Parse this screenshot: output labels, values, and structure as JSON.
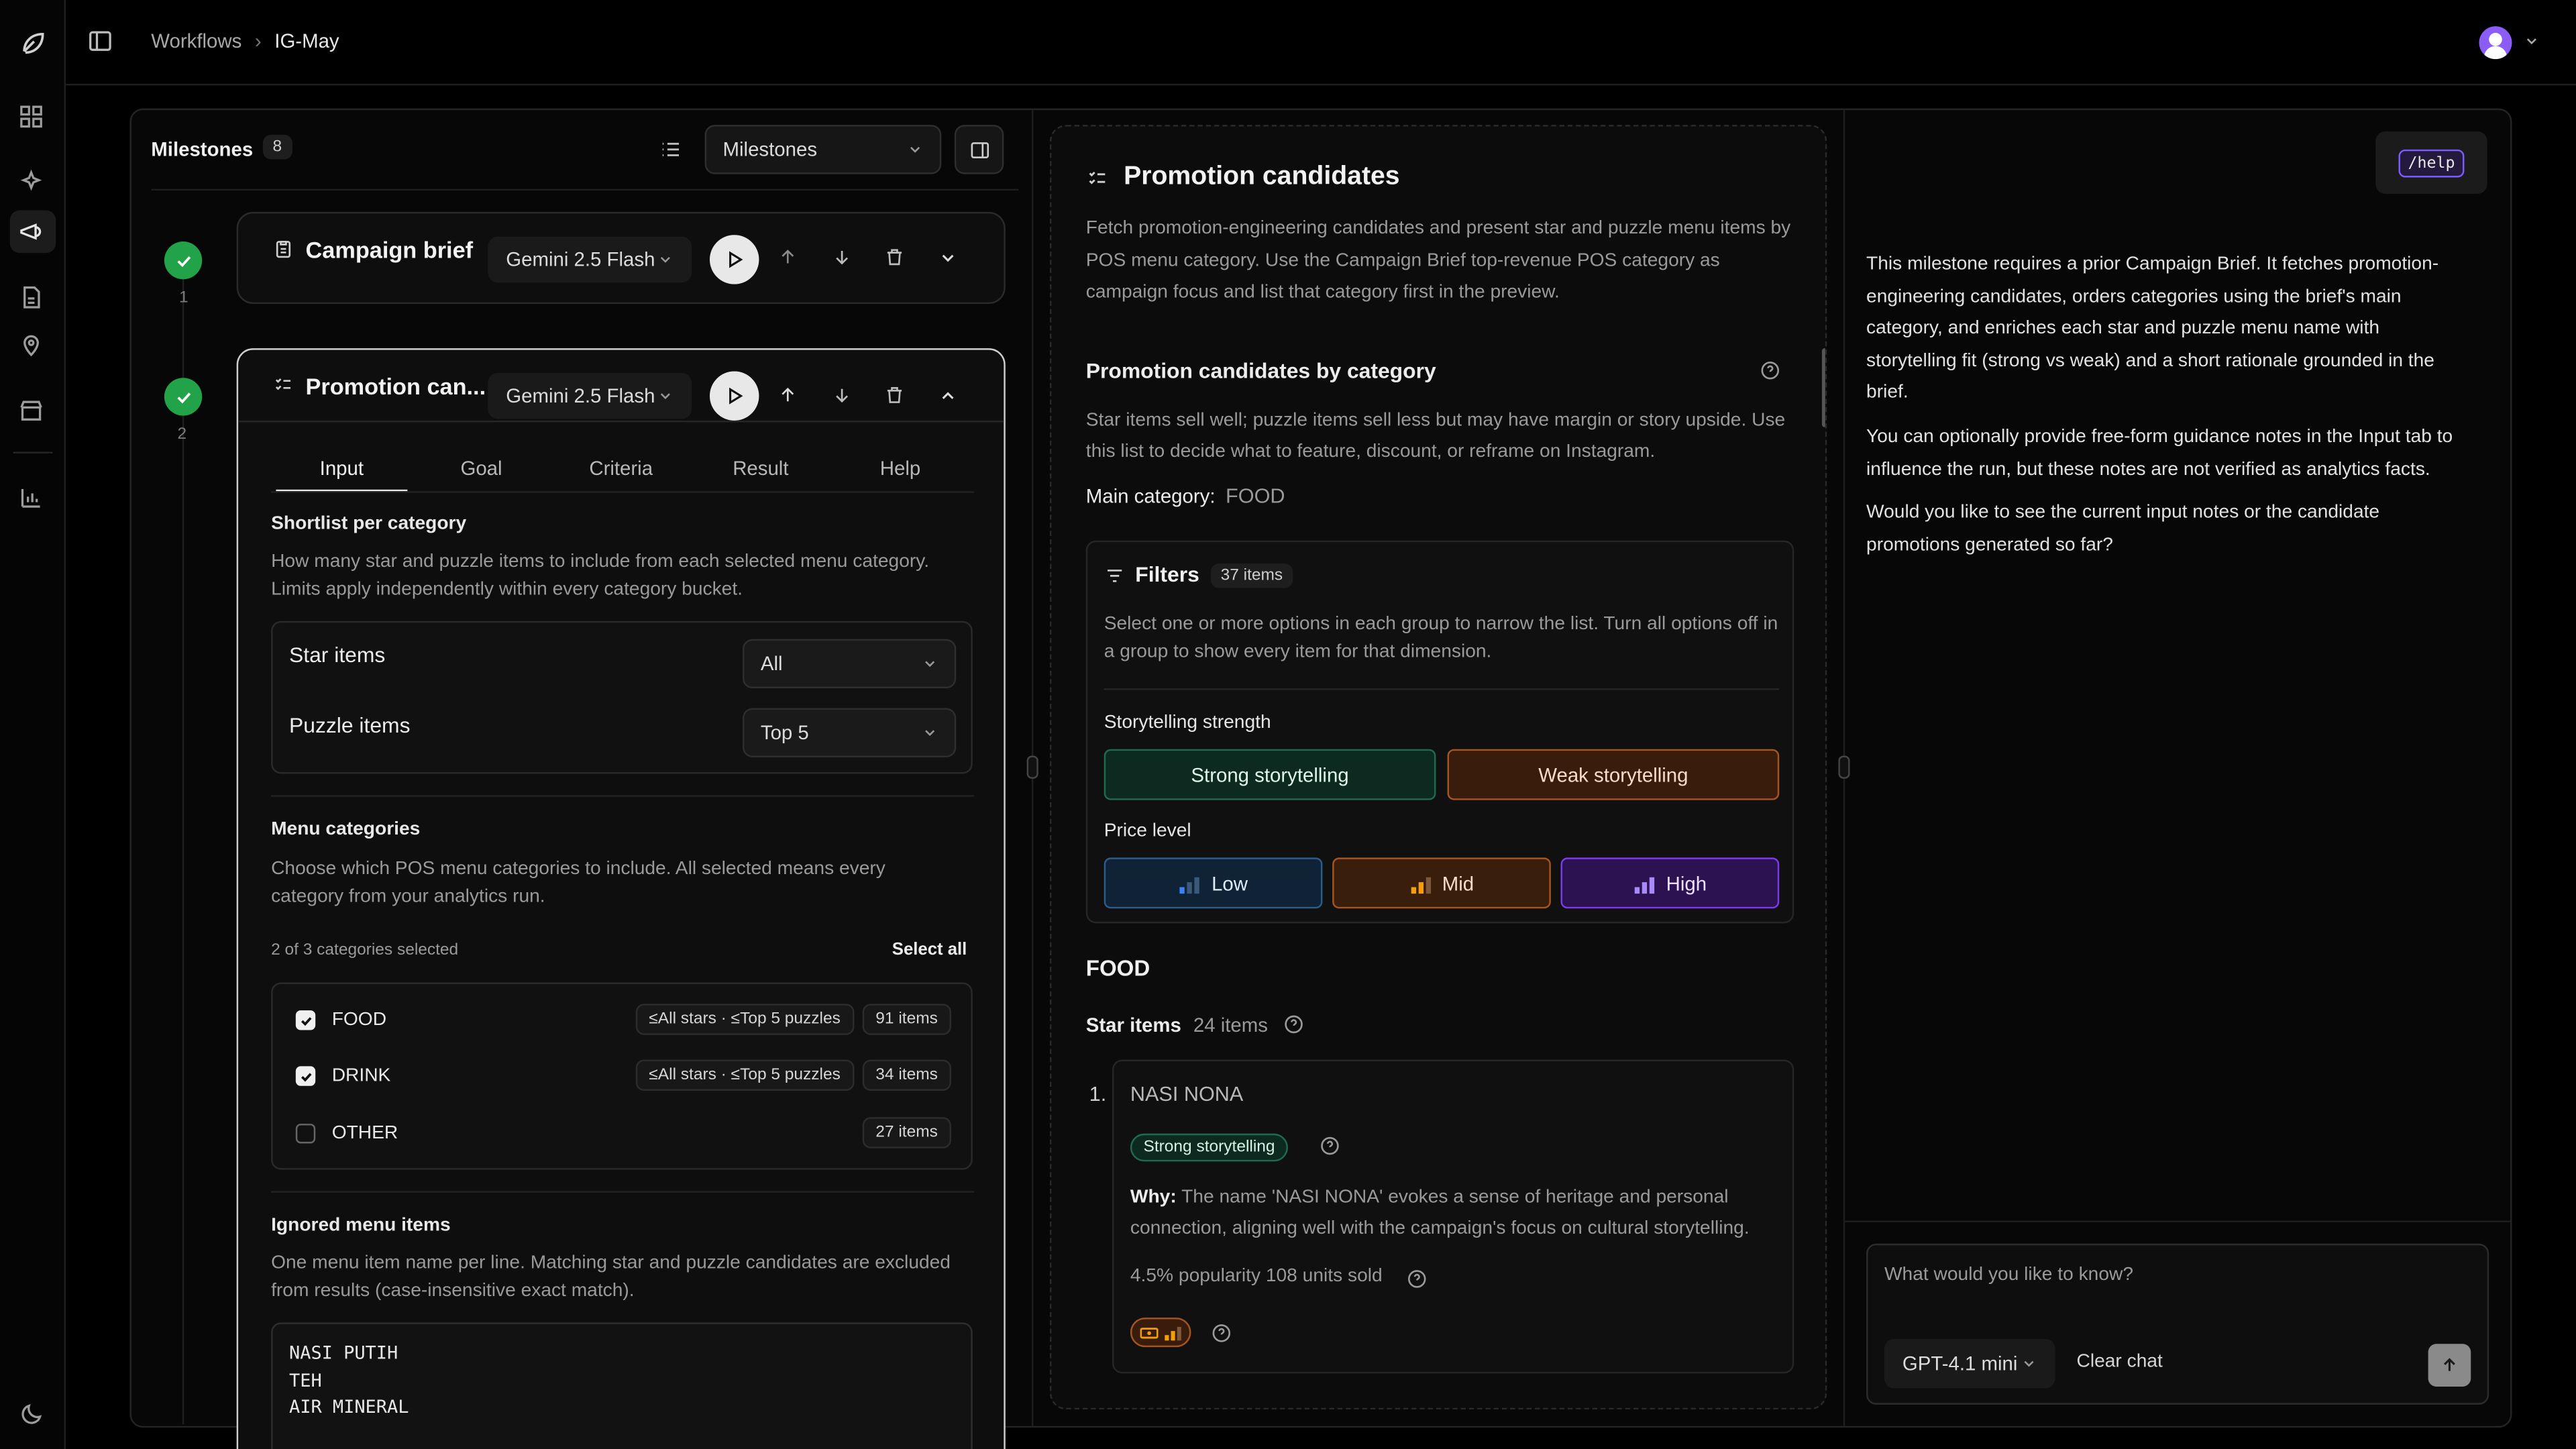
{
  "breadcrumb": {
    "root": "Workflows",
    "current": "IG-May"
  },
  "milestones": {
    "title": "Milestones",
    "count": "8",
    "select_value": "Milestones",
    "items": [
      {
        "number": "1",
        "title": "Campaign brief",
        "model": "Gemini 2.5 Flash"
      },
      {
        "number": "2",
        "title": "Promotion can...",
        "model": "Gemini 2.5 Flash"
      }
    ]
  },
  "editor": {
    "tabs": [
      "Input",
      "Goal",
      "Criteria",
      "Result",
      "Help"
    ],
    "shortlist": {
      "heading": "Shortlist per category",
      "description": "How many star and puzzle items to include from each selected menu category. Limits apply independently within every category bucket.",
      "star_label": "Star items",
      "star_value": "All",
      "puzzle_label": "Puzzle items",
      "puzzle_value": "Top 5"
    },
    "categories": {
      "heading": "Menu categories",
      "description": "Choose which POS menu categories to include. All selected means every category from your analytics run.",
      "selected_count": "2 of 3 categories selected",
      "select_all": "Select all",
      "rows": [
        {
          "name": "FOOD",
          "limits": "≤All stars · ≤Top 5 puzzles",
          "count": "91 items",
          "checked": true
        },
        {
          "name": "DRINK",
          "limits": "≤All stars · ≤Top 5 puzzles",
          "count": "34 items",
          "checked": true
        },
        {
          "name": "OTHER",
          "limits": "",
          "count": "27 items",
          "checked": false
        }
      ]
    },
    "ignored": {
      "heading": "Ignored menu items",
      "description": "One menu item name per line. Matching star and puzzle candidates are excluded from results (case-insensitive exact match).",
      "lines": [
        "NASI PUTIH",
        "TEH",
        "AIR MINERAL"
      ]
    }
  },
  "preview": {
    "title": "Promotion candidates",
    "description": "Fetch promotion-engineering candidates and present star and puzzle menu items by POS menu category. Use the Campaign Brief top-revenue POS category as campaign focus and list that category first in the preview.",
    "section_title": "Promotion candidates by category",
    "section_desc": "Star items sell well; puzzle items sell less but may have margin or story upside. Use this list to decide what to feature, discount, or reframe on Instagram.",
    "main_category_label": "Main category:",
    "main_category_value": "FOOD",
    "filters": {
      "title": "Filters",
      "count": "37 items",
      "description": "Select one or more options in each group to narrow the list. Turn all options off in a group to show every item for that dimension.",
      "storytelling_label": "Storytelling strength",
      "strong": "Strong storytelling",
      "weak": "Weak storytelling",
      "price_label": "Price level",
      "low": "Low",
      "mid": "Mid",
      "high": "High"
    },
    "category_heading": "FOOD",
    "star_label": "Star items",
    "star_count": "24 items",
    "item": {
      "index": "1.",
      "name": "NASI NONA",
      "tag": "Strong storytelling",
      "why_label": "Why:",
      "why_text": "The name 'NASI NONA' evokes a sense of heritage and personal connection, aligning well with the campaign's focus on cultural storytelling.",
      "stats": "4.5% popularity 108 units sold"
    }
  },
  "chat": {
    "help_chip": "/help",
    "messages": [
      "This milestone requires a prior Campaign Brief. It fetches promotion-engineering candidates, orders categories using the brief's main category, and enriches each star and puzzle menu name with storytelling fit (strong vs weak) and a short rationale grounded in the brief.",
      "You can optionally provide free-form guidance notes in the Input tab to influence the run, but these notes are not verified as analytics facts.",
      "Would you like to see the current input notes or the candidate promotions generated so far?"
    ],
    "placeholder": "What would you like to know?",
    "model": "GPT-4.1 mini",
    "clear": "Clear chat"
  },
  "colors": {
    "success": "#22a34a",
    "strong_bg": "#0d2a20",
    "weak_bg": "#3a1c0c",
    "low_bg": "#0f2236",
    "mid_bg": "#3a1e0c",
    "high_bg": "#2c1250",
    "help_chip": "#7c5cff"
  }
}
